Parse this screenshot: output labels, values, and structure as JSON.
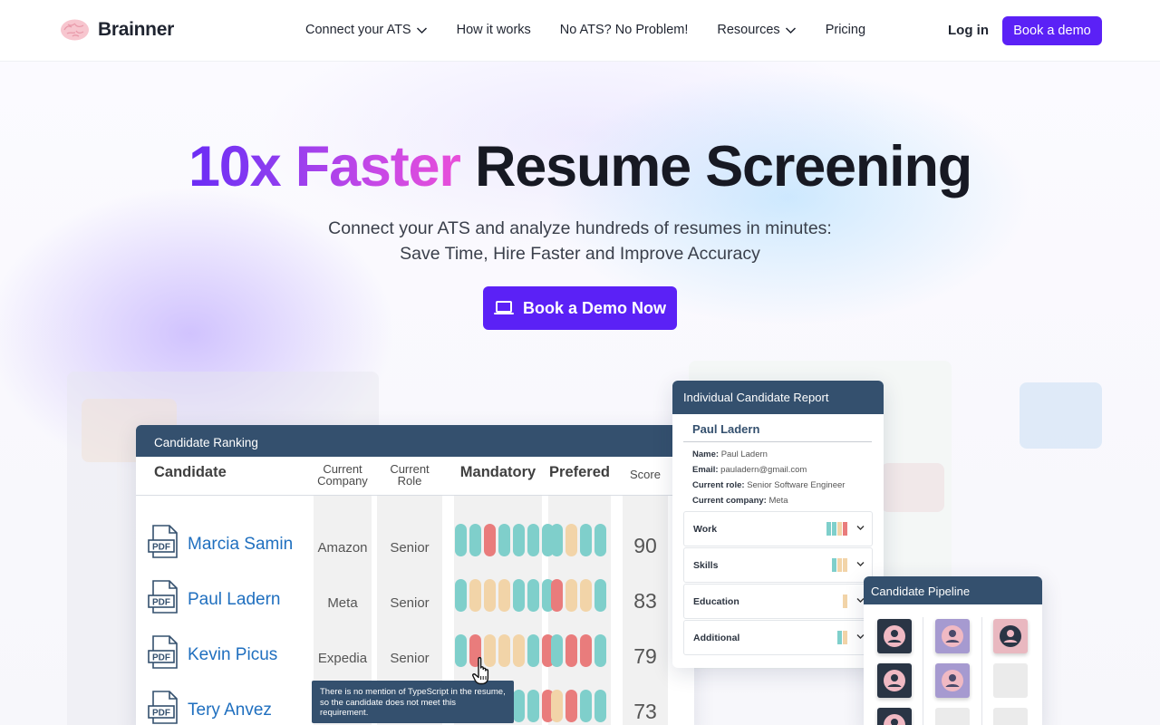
{
  "brand": {
    "name": "Brainner"
  },
  "nav": {
    "links": [
      "Connect your ATS",
      "How it works",
      "No ATS? No Problem!",
      "Resources",
      "Pricing"
    ],
    "login": "Log in",
    "book_demo": "Book a demo"
  },
  "hero": {
    "headline_highlight": "10x Faster",
    "headline_rest": "Resume Screening",
    "subtitle_line1": "Connect your ATS and analyze hundreds of resumes in minutes:",
    "subtitle_line2": "Save Time, Hire Faster and Improve Accuracy",
    "cta": "Book a Demo Now"
  },
  "ranking": {
    "title": "Candidate Ranking",
    "headers": {
      "candidate": "Candidate",
      "company": "Current Company",
      "role": "Current Role",
      "mandatory": "Mandatory",
      "preferred": "Prefered",
      "score": "Score"
    },
    "rows": [
      {
        "name": "Marcia Samin",
        "company": "Amazon",
        "role": "Senior",
        "score": "90",
        "mandatory": [
          "t",
          "t",
          "r",
          "t",
          "t",
          "t",
          "t"
        ],
        "preferred": [
          "t",
          "y",
          "t",
          "t"
        ]
      },
      {
        "name": "Paul Ladern",
        "company": "Meta",
        "role": "Senior",
        "score": "83",
        "mandatory": [
          "t",
          "y",
          "y",
          "y",
          "t",
          "t",
          "t"
        ],
        "preferred": [
          "r",
          "y",
          "y",
          "t"
        ]
      },
      {
        "name": "Kevin Picus",
        "company": "Expedia",
        "role": "Senior",
        "score": "79",
        "mandatory": [
          "t",
          "r",
          "y",
          "y",
          "y",
          "t",
          "r"
        ],
        "preferred": [
          "t",
          "r",
          "r",
          "t"
        ]
      },
      {
        "name": "Tery Anvez",
        "company": "",
        "role": "",
        "score": "73",
        "mandatory": [
          "t",
          "t",
          "t",
          "t",
          "t",
          "t",
          "r"
        ],
        "preferred": [
          "y",
          "r",
          "t",
          "t"
        ]
      }
    ],
    "tooltip": "There is no mention of TypeScript in the resume, so the candidate does not meet this requirement."
  },
  "report": {
    "title": "Individual Candidate Report",
    "candidate_name": "Paul Ladern",
    "fields": [
      {
        "label": "Name:",
        "value": "Paul Ladern"
      },
      {
        "label": "Email:",
        "value": "pauladern@gmail.com"
      },
      {
        "label": "Current role:",
        "value": "Senior Software Engineer"
      },
      {
        "label": "Current company:",
        "value": "Meta"
      }
    ],
    "sections": [
      "Work",
      "Skills",
      "Education",
      "Additional"
    ]
  },
  "pipeline": {
    "title": "Candidate Pipeline"
  },
  "colors": {
    "brand_purple": "#5b21f6",
    "card_header": "#34506e",
    "pill_teal": "#7fcfcb",
    "pill_red": "#e97c7c",
    "pill_yellow": "#f2d4a8"
  }
}
